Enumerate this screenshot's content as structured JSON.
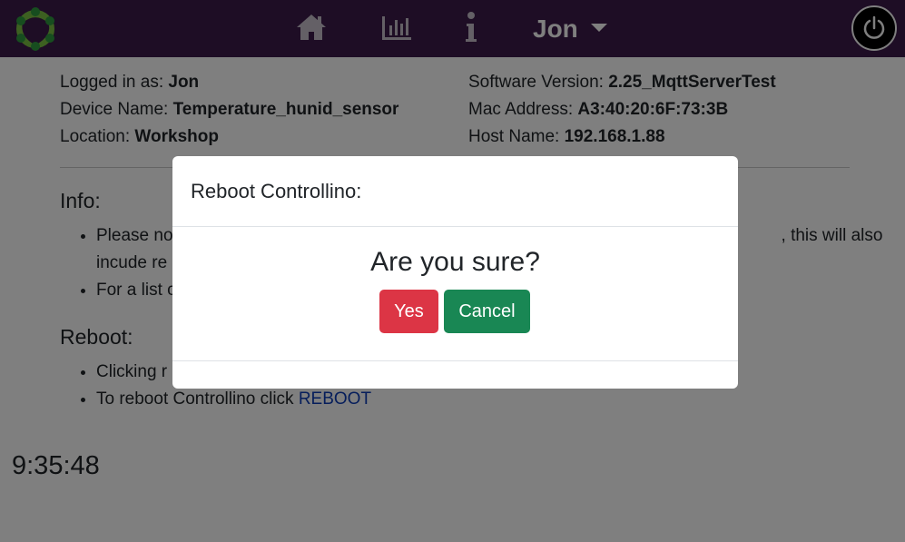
{
  "nav": {
    "user": "Jon",
    "icons": [
      "logo-icon",
      "home-icon",
      "chart-icon",
      "info-icon",
      "caret-down-icon",
      "power-icon"
    ],
    "accent_color": "#3d1b4b"
  },
  "device": {
    "logged_in_label": "Logged in as:",
    "logged_in_value": "Jon",
    "device_name_label": "Device Name:",
    "device_name_value": "Temperature_hunid_sensor",
    "location_label": "Location:",
    "location_value": "Workshop",
    "software_label": "Software Version:",
    "software_value": "2.25_MqttServerTest",
    "mac_label": "Mac Address:",
    "mac_value": "A3:40:20:6F:73:3B",
    "host_label": "Host Name:",
    "host_value": "192.168.1.88"
  },
  "info": {
    "title": "Info:",
    "bullet1": "Please no",
    "bullet1_tail": ", this will also",
    "bullet1_line2": "incude re",
    "bullet2": "For a list c"
  },
  "reboot": {
    "title": "Reboot:",
    "bullet1": "Clicking r",
    "bullet2_text": "To reboot Controllino click ",
    "bullet2_link": "REBOOT"
  },
  "clock": "9:35:48",
  "modal": {
    "title": "Reboot Controllino:",
    "question": "Are you sure?",
    "yes": "Yes",
    "cancel": "Cancel",
    "yes_color": "#dc3545",
    "cancel_color": "#198754"
  }
}
